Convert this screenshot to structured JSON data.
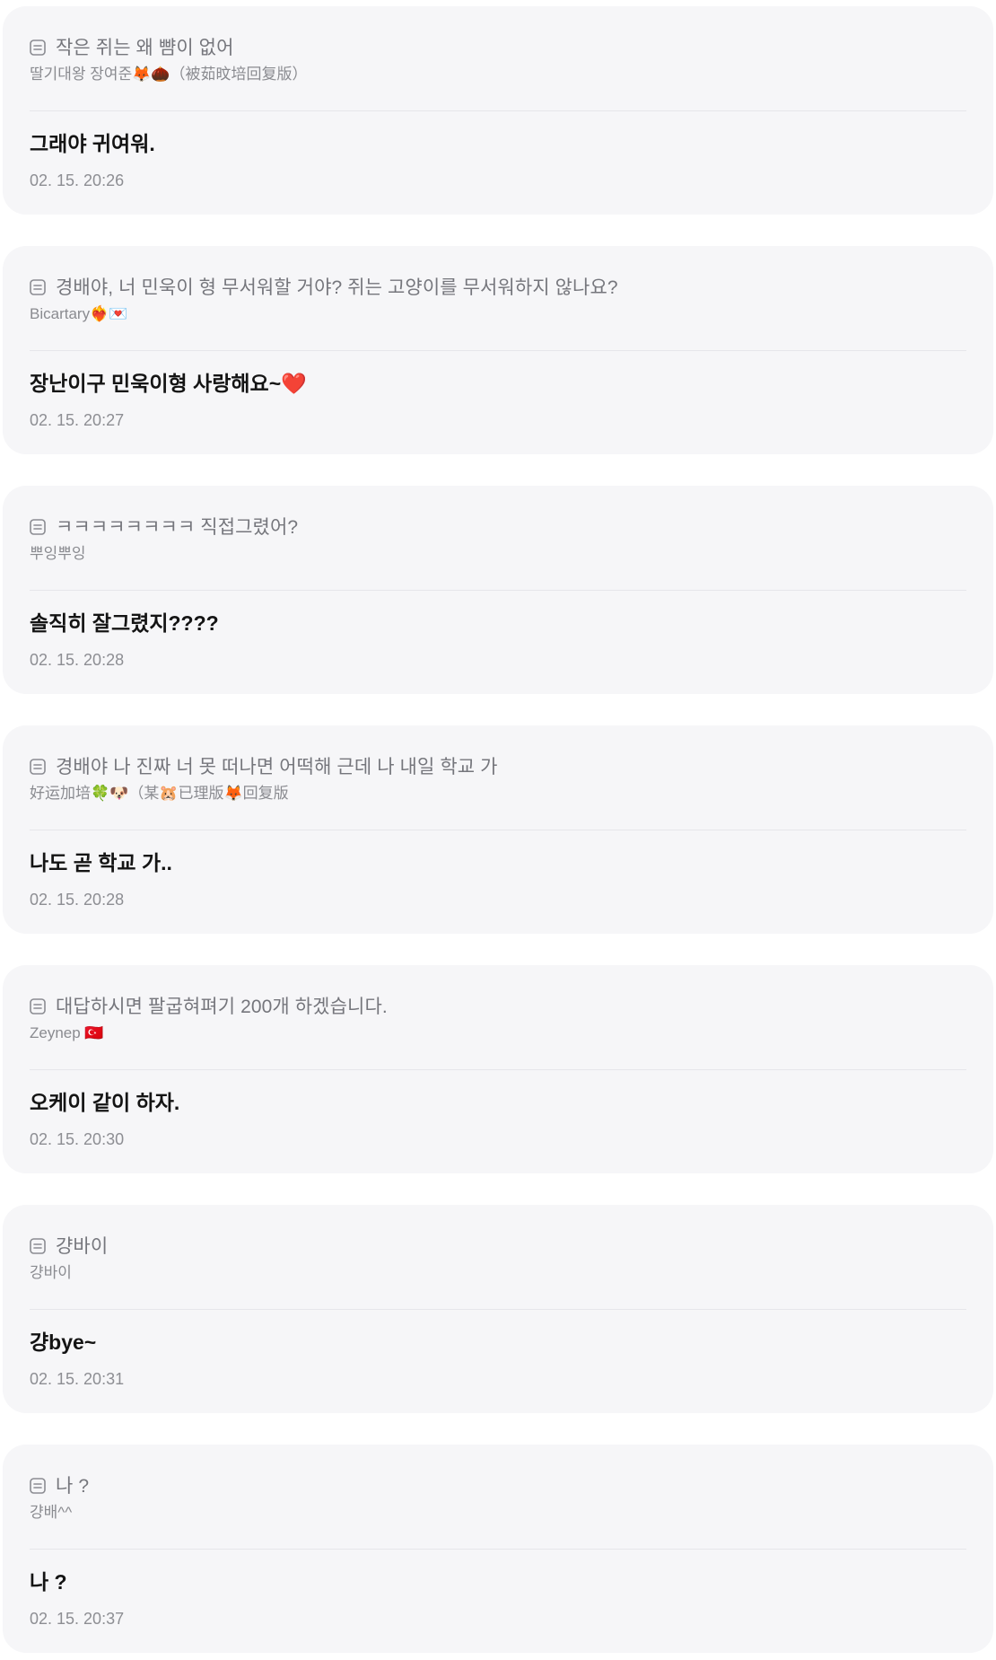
{
  "icons": {
    "question": "question-note-icon"
  },
  "colors": {
    "card_background": "#f6f6f8",
    "question_text": "#75767c",
    "answer_text": "#141414",
    "meta_text": "#8d8e93"
  },
  "messages": [
    {
      "question": "작은 쥐는 왜 뺨이 없어",
      "author": "딸기대왕 장여준🦊🌰（被茹旼培回复版）",
      "answer": "그래야 귀여워.",
      "time": "02. 15. 20:26"
    },
    {
      "question": "경배야, 너 민욱이 형 무서워할 거야? 쥐는 고양이를 무서워하지 않나요?",
      "author": "Bicartary❤️‍🔥💌",
      "answer": "장난이구 민욱이형 사랑해요~❤️",
      "time": "02. 15. 20:27"
    },
    {
      "question": "ㅋㅋㅋㅋㅋㅋㅋㅋ 직접그렸어?",
      "author": "뿌잉뿌잉",
      "answer": "솔직히 잘그렸지????",
      "time": "02. 15. 20:28"
    },
    {
      "question": "경배야 나 진짜 너 못 떠나면 어떡해 근데 나 내일 학교 가",
      "author": "好运加培🍀🐶（某🐹已理版🦊回复版",
      "answer": "나도 곧 학교 가..",
      "time": "02. 15. 20:28"
    },
    {
      "question": "대답하시면 팔굽혀펴기 200개 하겠습니다.",
      "author": "Zeynep 🇹🇷",
      "answer": "오케이 같이 하자.",
      "time": "02. 15. 20:30"
    },
    {
      "question": "걍바이",
      "author": "걍바이",
      "answer": "걍bye~",
      "time": "02. 15. 20:31"
    },
    {
      "question": "나 ?",
      "author": "걍배^^",
      "answer": "나 ?",
      "time": "02. 15. 20:37"
    }
  ]
}
